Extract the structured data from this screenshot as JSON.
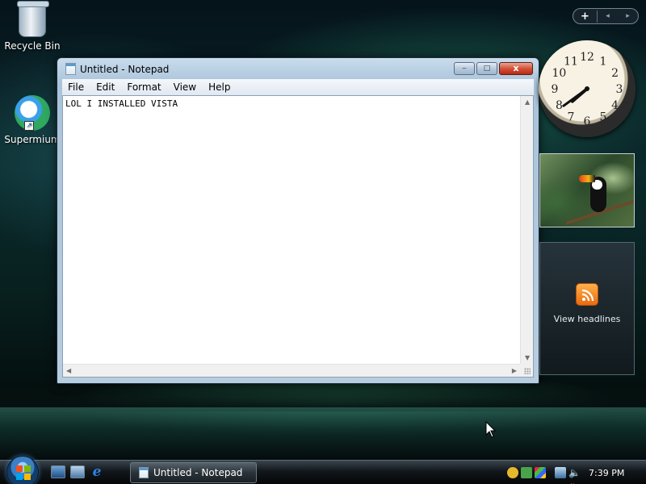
{
  "desktop": {
    "icons": [
      {
        "label": "Recycle Bin",
        "icon": "recycle-bin-icon"
      },
      {
        "label": "Supermium",
        "icon": "supermium-browser-icon"
      }
    ]
  },
  "notepad": {
    "title": "Untitled - Notepad",
    "window_buttons": {
      "minimize": "‒",
      "maximize": "□",
      "close": "x"
    },
    "menu": [
      "File",
      "Edit",
      "Format",
      "View",
      "Help"
    ],
    "content": "LOL I INSTALLED VISTA"
  },
  "sidebar": {
    "add_label": "+",
    "prev_label": "◂",
    "next_label": "▸",
    "clock": {
      "time": "7:39",
      "numerals": [
        "12",
        "1",
        "2",
        "3",
        "4",
        "5",
        "6",
        "7",
        "8",
        "9",
        "10",
        "11"
      ]
    },
    "slideshow": {
      "subject": "toucan photo"
    },
    "feeds": {
      "label": "View headlines",
      "icon": "rss-icon"
    }
  },
  "taskbar": {
    "start_icon": "windows-logo-icon",
    "quick_launch": [
      "show-desktop-icon",
      "switch-windows-icon",
      "internet-explorer-icon"
    ],
    "ie_glyph": "e",
    "active_task": "Untitled - Notepad",
    "tray_icons": [
      "security-shield-icon",
      "windows-update-icon",
      "security-center-icon",
      "network-icon",
      "volume-muted-icon"
    ],
    "clock": "7:39 PM"
  }
}
